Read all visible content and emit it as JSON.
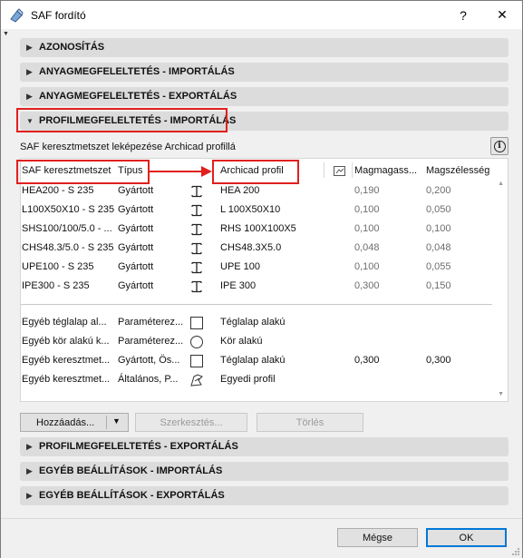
{
  "window": {
    "title": "SAF fordító",
    "help_glyph": "?",
    "close_glyph": "✕"
  },
  "sections": {
    "azonositas": "AZONOSÍTÁS",
    "anyag_import": "ANYAGMEGFELELTETÉS - IMPORTÁLÁS",
    "anyag_export": "ANYAGMEGFELELTETÉS - EXPORTÁLÁS",
    "profil_import": "PROFILMEGFELELTETÉS - IMPORTÁLÁS",
    "profil_export": "PROFILMEGFELELTETÉS - EXPORTÁLÁS",
    "egyeb_import": "EGYÉB BEÁLLÍTÁSOK - IMPORTÁLÁS",
    "egyeb_export": "EGYÉB BEÁLLÍTÁSOK - EXPORTÁLÁS"
  },
  "description": "SAF keresztmetszet leképezése Archicad profillá",
  "info_glyph": "i",
  "table": {
    "headers": {
      "saf": "SAF keresztmetszet",
      "tipus": "Típus",
      "archicad": "Archicad profil",
      "magassag": "Magmagass...",
      "szelesseg": "Magszélesség"
    },
    "rows": [
      {
        "saf": "HEA200 - S 235",
        "tipus": "Gyártott",
        "icon": "i-beam-icon",
        "profil": "HEA 200",
        "mag": "0,190",
        "szel": "0,200"
      },
      {
        "saf": "L100X50X10 - S 235",
        "tipus": "Gyártott",
        "icon": "i-beam-icon",
        "profil": "L 100X50X10",
        "mag": "0,100",
        "szel": "0,050"
      },
      {
        "saf": "SHS100/100/5.0 - ...",
        "tipus": "Gyártott",
        "icon": "i-beam-icon",
        "profil": "RHS 100X100X5",
        "mag": "0,100",
        "szel": "0,100"
      },
      {
        "saf": "CHS48.3/5.0 - S 235",
        "tipus": "Gyártott",
        "icon": "i-beam-icon",
        "profil": "CHS48.3X5.0",
        "mag": "0,048",
        "szel": "0,048"
      },
      {
        "saf": "UPE100 - S 235",
        "tipus": "Gyártott",
        "icon": "i-beam-icon",
        "profil": "UPE 100",
        "mag": "0,100",
        "szel": "0,055"
      },
      {
        "saf": "IPE300 - S 235",
        "tipus": "Gyártott",
        "icon": "i-beam-icon",
        "profil": "IPE 300",
        "mag": "0,300",
        "szel": "0,150"
      }
    ],
    "other_rows": [
      {
        "saf": "Egyéb téglalap al...",
        "tipus": "Paraméterez...",
        "icon": "rectangle-icon",
        "profil": "Téglalap alakú",
        "mag": "",
        "szel": ""
      },
      {
        "saf": "Egyéb kör alakú k...",
        "tipus": "Paraméterez...",
        "icon": "circle-icon",
        "profil": "Kör alakú",
        "mag": "",
        "szel": ""
      },
      {
        "saf": "Egyéb keresztmet...",
        "tipus": "Gyártott, Ös...",
        "icon": "rectangle-icon",
        "profil": "Téglalap alakú",
        "mag": "0,300",
        "szel": "0,300"
      },
      {
        "saf": "Egyéb keresztmet...",
        "tipus": "Általános, P...",
        "icon": "custom-profile-icon",
        "profil": "Egyedi profil",
        "mag": "",
        "szel": ""
      }
    ]
  },
  "buttons": {
    "add": "Hozzáadás...",
    "edit": "Szerkesztés...",
    "delete": "Törlés",
    "cancel": "Mégse",
    "ok": "OK"
  },
  "colors": {
    "highlight": "#e0201e",
    "section_bg": "#dcdcdc",
    "accent": "#0078d7"
  }
}
